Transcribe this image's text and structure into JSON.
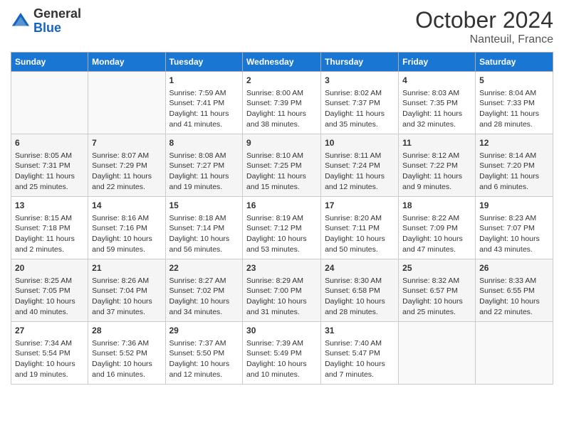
{
  "header": {
    "logo_general": "General",
    "logo_blue": "Blue",
    "month_year": "October 2024",
    "location": "Nanteuil, France"
  },
  "weekdays": [
    "Sunday",
    "Monday",
    "Tuesday",
    "Wednesday",
    "Thursday",
    "Friday",
    "Saturday"
  ],
  "weeks": [
    [
      {
        "day": "",
        "empty": true
      },
      {
        "day": "",
        "empty": true
      },
      {
        "day": "1",
        "sunrise": "Sunrise: 7:59 AM",
        "sunset": "Sunset: 7:41 PM",
        "daylight": "Daylight: 11 hours and 41 minutes."
      },
      {
        "day": "2",
        "sunrise": "Sunrise: 8:00 AM",
        "sunset": "Sunset: 7:39 PM",
        "daylight": "Daylight: 11 hours and 38 minutes."
      },
      {
        "day": "3",
        "sunrise": "Sunrise: 8:02 AM",
        "sunset": "Sunset: 7:37 PM",
        "daylight": "Daylight: 11 hours and 35 minutes."
      },
      {
        "day": "4",
        "sunrise": "Sunrise: 8:03 AM",
        "sunset": "Sunset: 7:35 PM",
        "daylight": "Daylight: 11 hours and 32 minutes."
      },
      {
        "day": "5",
        "sunrise": "Sunrise: 8:04 AM",
        "sunset": "Sunset: 7:33 PM",
        "daylight": "Daylight: 11 hours and 28 minutes."
      }
    ],
    [
      {
        "day": "6",
        "sunrise": "Sunrise: 8:05 AM",
        "sunset": "Sunset: 7:31 PM",
        "daylight": "Daylight: 11 hours and 25 minutes."
      },
      {
        "day": "7",
        "sunrise": "Sunrise: 8:07 AM",
        "sunset": "Sunset: 7:29 PM",
        "daylight": "Daylight: 11 hours and 22 minutes."
      },
      {
        "day": "8",
        "sunrise": "Sunrise: 8:08 AM",
        "sunset": "Sunset: 7:27 PM",
        "daylight": "Daylight: 11 hours and 19 minutes."
      },
      {
        "day": "9",
        "sunrise": "Sunrise: 8:10 AM",
        "sunset": "Sunset: 7:25 PM",
        "daylight": "Daylight: 11 hours and 15 minutes."
      },
      {
        "day": "10",
        "sunrise": "Sunrise: 8:11 AM",
        "sunset": "Sunset: 7:24 PM",
        "daylight": "Daylight: 11 hours and 12 minutes."
      },
      {
        "day": "11",
        "sunrise": "Sunrise: 8:12 AM",
        "sunset": "Sunset: 7:22 PM",
        "daylight": "Daylight: 11 hours and 9 minutes."
      },
      {
        "day": "12",
        "sunrise": "Sunrise: 8:14 AM",
        "sunset": "Sunset: 7:20 PM",
        "daylight": "Daylight: 11 hours and 6 minutes."
      }
    ],
    [
      {
        "day": "13",
        "sunrise": "Sunrise: 8:15 AM",
        "sunset": "Sunset: 7:18 PM",
        "daylight": "Daylight: 11 hours and 2 minutes."
      },
      {
        "day": "14",
        "sunrise": "Sunrise: 8:16 AM",
        "sunset": "Sunset: 7:16 PM",
        "daylight": "Daylight: 10 hours and 59 minutes."
      },
      {
        "day": "15",
        "sunrise": "Sunrise: 8:18 AM",
        "sunset": "Sunset: 7:14 PM",
        "daylight": "Daylight: 10 hours and 56 minutes."
      },
      {
        "day": "16",
        "sunrise": "Sunrise: 8:19 AM",
        "sunset": "Sunset: 7:12 PM",
        "daylight": "Daylight: 10 hours and 53 minutes."
      },
      {
        "day": "17",
        "sunrise": "Sunrise: 8:20 AM",
        "sunset": "Sunset: 7:11 PM",
        "daylight": "Daylight: 10 hours and 50 minutes."
      },
      {
        "day": "18",
        "sunrise": "Sunrise: 8:22 AM",
        "sunset": "Sunset: 7:09 PM",
        "daylight": "Daylight: 10 hours and 47 minutes."
      },
      {
        "day": "19",
        "sunrise": "Sunrise: 8:23 AM",
        "sunset": "Sunset: 7:07 PM",
        "daylight": "Daylight: 10 hours and 43 minutes."
      }
    ],
    [
      {
        "day": "20",
        "sunrise": "Sunrise: 8:25 AM",
        "sunset": "Sunset: 7:05 PM",
        "daylight": "Daylight: 10 hours and 40 minutes."
      },
      {
        "day": "21",
        "sunrise": "Sunrise: 8:26 AM",
        "sunset": "Sunset: 7:04 PM",
        "daylight": "Daylight: 10 hours and 37 minutes."
      },
      {
        "day": "22",
        "sunrise": "Sunrise: 8:27 AM",
        "sunset": "Sunset: 7:02 PM",
        "daylight": "Daylight: 10 hours and 34 minutes."
      },
      {
        "day": "23",
        "sunrise": "Sunrise: 8:29 AM",
        "sunset": "Sunset: 7:00 PM",
        "daylight": "Daylight: 10 hours and 31 minutes."
      },
      {
        "day": "24",
        "sunrise": "Sunrise: 8:30 AM",
        "sunset": "Sunset: 6:58 PM",
        "daylight": "Daylight: 10 hours and 28 minutes."
      },
      {
        "day": "25",
        "sunrise": "Sunrise: 8:32 AM",
        "sunset": "Sunset: 6:57 PM",
        "daylight": "Daylight: 10 hours and 25 minutes."
      },
      {
        "day": "26",
        "sunrise": "Sunrise: 8:33 AM",
        "sunset": "Sunset: 6:55 PM",
        "daylight": "Daylight: 10 hours and 22 minutes."
      }
    ],
    [
      {
        "day": "27",
        "sunrise": "Sunrise: 7:34 AM",
        "sunset": "Sunset: 5:54 PM",
        "daylight": "Daylight: 10 hours and 19 minutes."
      },
      {
        "day": "28",
        "sunrise": "Sunrise: 7:36 AM",
        "sunset": "Sunset: 5:52 PM",
        "daylight": "Daylight: 10 hours and 16 minutes."
      },
      {
        "day": "29",
        "sunrise": "Sunrise: 7:37 AM",
        "sunset": "Sunset: 5:50 PM",
        "daylight": "Daylight: 10 hours and 12 minutes."
      },
      {
        "day": "30",
        "sunrise": "Sunrise: 7:39 AM",
        "sunset": "Sunset: 5:49 PM",
        "daylight": "Daylight: 10 hours and 10 minutes."
      },
      {
        "day": "31",
        "sunrise": "Sunrise: 7:40 AM",
        "sunset": "Sunset: 5:47 PM",
        "daylight": "Daylight: 10 hours and 7 minutes."
      },
      {
        "day": "",
        "empty": true
      },
      {
        "day": "",
        "empty": true
      }
    ]
  ]
}
